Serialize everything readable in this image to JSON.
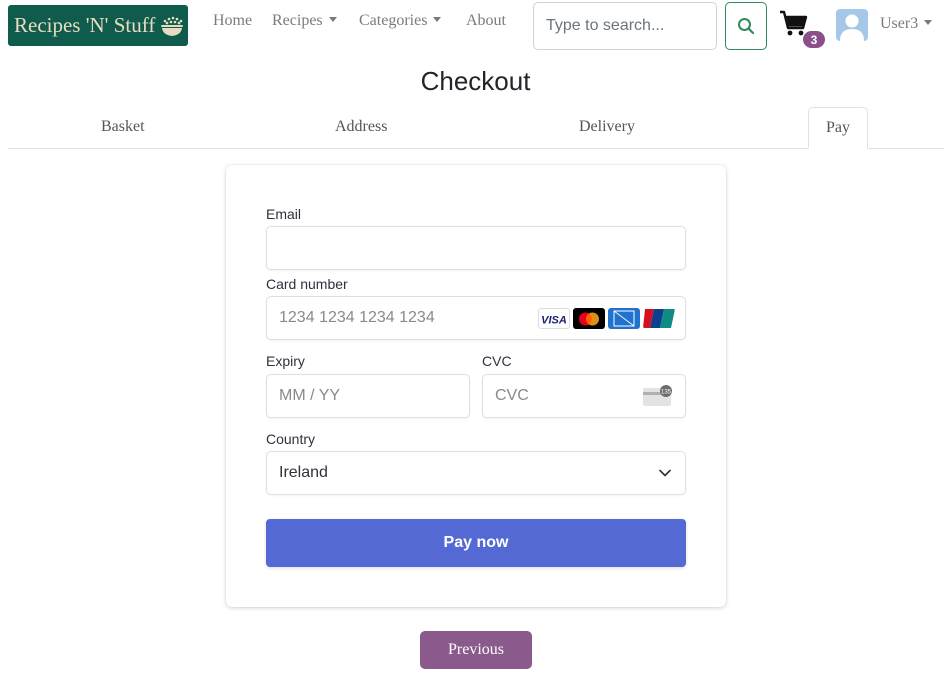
{
  "navbar": {
    "brand": "Recipes 'N' Stuff",
    "links": [
      {
        "label": "Home"
      },
      {
        "label": "Recipes"
      },
      {
        "label": "Categories"
      },
      {
        "label": "About"
      }
    ],
    "search_placeholder": "Type to search...",
    "cart_count": "3",
    "user": "User3"
  },
  "page": {
    "title": "Checkout",
    "tabs": [
      "Basket",
      "Address",
      "Delivery",
      "Pay"
    ],
    "active_tab": "Pay"
  },
  "payment_form": {
    "email_label": "Email",
    "email_value": "",
    "card_label": "Card number",
    "card_placeholder": "1234 1234 1234 1234",
    "card_brands": [
      "visa-logo",
      "mastercard-logo",
      "amex-logo",
      "unionpay-logo"
    ],
    "expiry_label": "Expiry",
    "expiry_placeholder": "MM / YY",
    "cvc_label": "CVC",
    "cvc_placeholder": "CVC",
    "country_label": "Country",
    "country_value": "Ireland",
    "pay_button": "Pay now"
  },
  "footer_nav": {
    "previous_button": "Previous"
  },
  "colors": {
    "brand_bg": "#0f5b4c",
    "accent_purple": "#8b5a8c",
    "pay_button": "#5469d4",
    "search_border": "#2e8b57"
  }
}
